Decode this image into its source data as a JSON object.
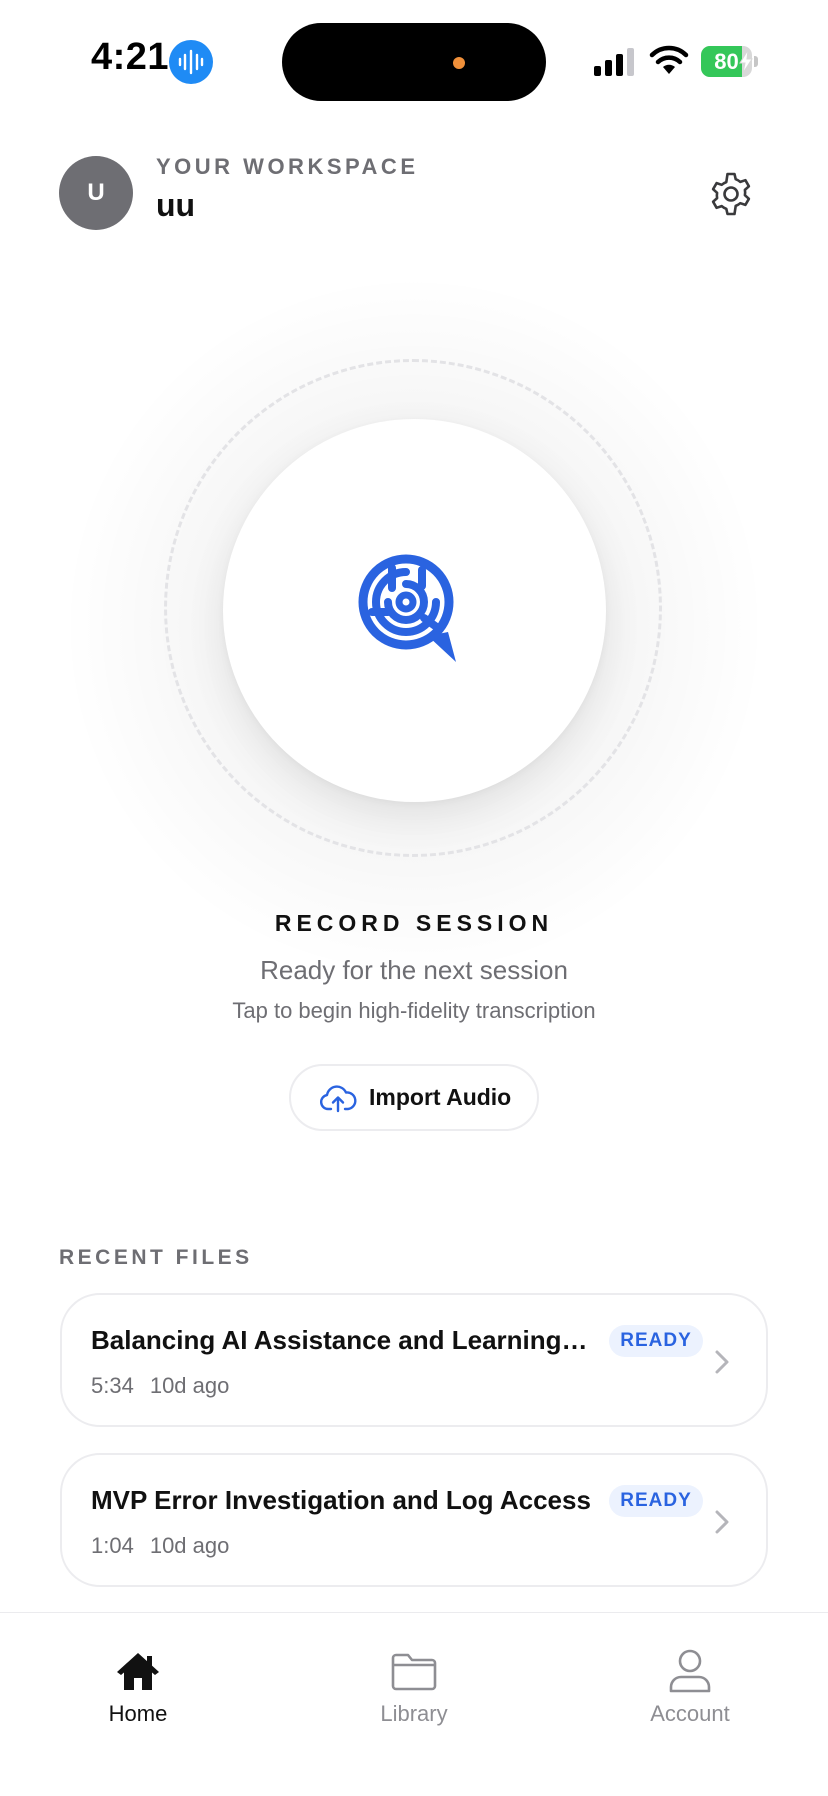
{
  "status_bar": {
    "time": "4:21",
    "battery_level": "80",
    "battery_fraction": 0.8,
    "battery_color": "#34c759",
    "icons": [
      "audio-waveform-icon",
      "cellular-signal-icon",
      "wifi-icon",
      "battery-icon",
      "charging-bolt-icon"
    ]
  },
  "header": {
    "avatar_initial": "U",
    "workspace_label": "YOUR WORKSPACE",
    "workspace_name": "uu",
    "settings_icon": "gear-icon"
  },
  "record": {
    "title": "RECORD SESSION",
    "subtitle": "Ready for the next session",
    "hint": "Tap to begin high-fidelity transcription",
    "logo_icon": "brain-chat-logo-icon",
    "accent_color": "#2a63e0"
  },
  "import_button": {
    "label": "Import Audio",
    "icon": "cloud-upload-icon"
  },
  "recent": {
    "label": "RECENT FILES",
    "files": [
      {
        "title": "Balancing AI Assistance and Learning i...",
        "duration": "5:34",
        "age": "10d ago",
        "status": "READY"
      },
      {
        "title": "MVP Error Investigation and Log Access",
        "duration": "1:04",
        "age": "10d ago",
        "status": "READY"
      }
    ]
  },
  "tabs": [
    {
      "label": "Home",
      "icon": "home-icon",
      "active": true
    },
    {
      "label": "Library",
      "icon": "folder-icon",
      "active": false
    },
    {
      "label": "Account",
      "icon": "person-icon",
      "active": false
    }
  ]
}
